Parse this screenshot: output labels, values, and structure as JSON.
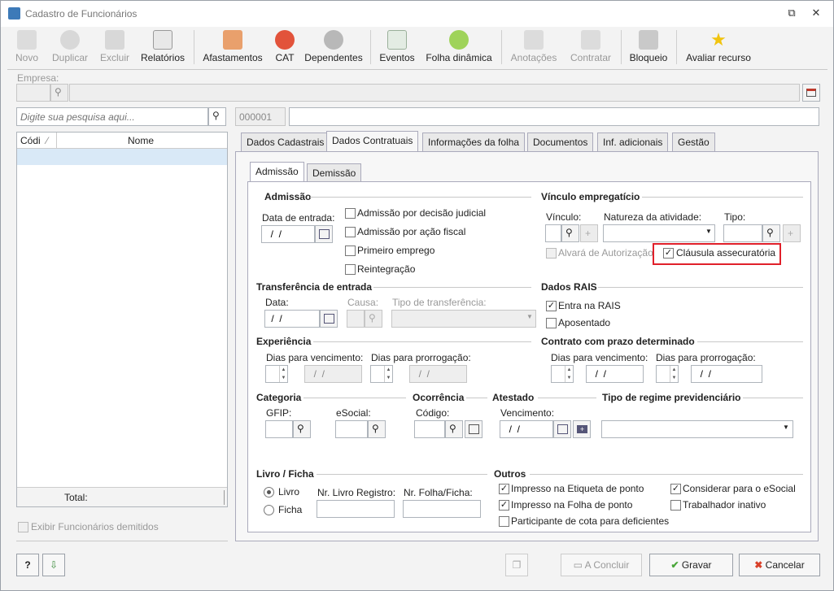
{
  "window": {
    "title": "Cadastro de Funcionários"
  },
  "toolbar": {
    "novo": "Novo",
    "duplicar": "Duplicar",
    "excluir": "Excluir",
    "relatorios": "Relatórios",
    "afastamentos": "Afastamentos",
    "cat": "CAT",
    "dependentes": "Dependentes",
    "eventos": "Eventos",
    "folha_dinamica": "Folha dinâmica",
    "anotacoes": "Anotações",
    "contratar": "Contratar",
    "bloqueio": "Bloqueio",
    "avaliar": "Avaliar recurso"
  },
  "empresa": {
    "label": "Empresa:"
  },
  "search": {
    "placeholder": "Digite sua pesquisa aqui...",
    "code": "000001"
  },
  "list": {
    "col_code": "Códi",
    "col_name": "Nome",
    "total_label": "Total:"
  },
  "show_fired": "Exibir Funcionários demitidos",
  "tabs": [
    "Dados Cadastrais",
    "Dados Contratuais",
    "Informações da folha",
    "Documentos",
    "Inf. adicionais",
    "Gestão"
  ],
  "subtabs": [
    "Admissão",
    "Demissão"
  ],
  "admissao": {
    "section": "Admissão",
    "data_entrada_label": "Data de entrada:",
    "data_entrada": "  /  /",
    "decisao_judicial": "Admissão por decisão judicial",
    "acao_fiscal": "Admissão por ação fiscal",
    "primeiro_emprego": "Primeiro emprego",
    "reintegracao": "Reintegração"
  },
  "vinculo": {
    "section": "Vínculo empregatício",
    "vinculo_label": "Vínculo:",
    "natureza_label": "Natureza da atividade:",
    "tipo_label": "Tipo:",
    "alvara": "Alvará de Autorização",
    "clausula": "Cláusula assecuratória"
  },
  "transferencia": {
    "section": "Transferência de entrada",
    "data_label": "Data:",
    "data": " /  /",
    "causa_label": "Causa:",
    "tipo_label": "Tipo de transferência:"
  },
  "rais": {
    "section": "Dados RAIS",
    "entra": "Entra na RAIS",
    "aposentado": "Aposentado"
  },
  "experiencia": {
    "section": "Experiência",
    "venc_label": "Dias para vencimento:",
    "prorr_label": "Dias para prorrogação:",
    "date1": "  /  /",
    "date2": "  /  /"
  },
  "contrato": {
    "section": "Contrato com prazo determinado",
    "venc_label": "Dias para vencimento:",
    "prorr_label": "Dias para prorrogação:",
    "date1": "  /  /",
    "date2": "  /  /"
  },
  "categoria": {
    "section": "Categoria",
    "gfip_label": "GFIP:",
    "esocial_label": "eSocial:"
  },
  "ocorrencia": {
    "section": "Ocorrência",
    "codigo_label": "Código:"
  },
  "atestado": {
    "section": "Atestado",
    "venc_label": "Vencimento:",
    "date": "  /  /"
  },
  "regime": {
    "section": "Tipo de regime previdenciário"
  },
  "livro": {
    "section": "Livro / Ficha",
    "livro": "Livro",
    "ficha": "Ficha",
    "nr_livro_label": "Nr. Livro Registro:",
    "nr_folha_label": "Nr. Folha/Ficha:"
  },
  "outros": {
    "section": "Outros",
    "etiqueta": "Impresso na Etiqueta de ponto",
    "folha_ponto": "Impresso na Folha de ponto",
    "cota": "Participante de cota para deficientes",
    "esocial": "Considerar para o eSocial",
    "inativo": "Trabalhador inativo"
  },
  "footer": {
    "help": "?",
    "concluir": "A Concluir",
    "gravar": "Gravar",
    "cancelar": "Cancelar"
  }
}
